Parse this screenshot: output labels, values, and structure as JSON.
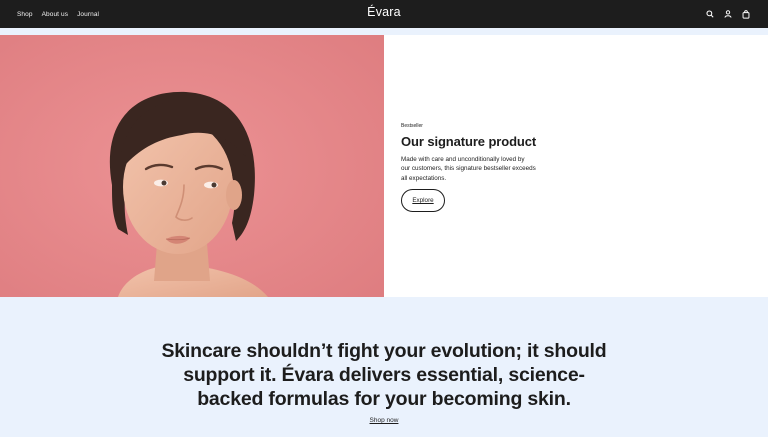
{
  "nav": {
    "items": [
      {
        "label": "Shop"
      },
      {
        "label": "About us"
      },
      {
        "label": "Journal"
      }
    ]
  },
  "brand": {
    "name": "Évara"
  },
  "header_icons": [
    "search-icon",
    "account-icon",
    "cart-icon"
  ],
  "hero": {
    "eyebrow": "Bestseller",
    "title": "Our signature product",
    "description_lines": [
      "Made with care and unconditionally loved by",
      "our customers, this signature bestseller exceeds",
      "all expectations."
    ],
    "cta": "Explore",
    "image_bg": "#e88689"
  },
  "band": {
    "tagline_lines": [
      "Skincare shouldn’t fight your evolution; it should",
      "support it. Évara delivers essential, science-",
      "backed formulas for your becoming skin."
    ],
    "cta": "Shop now"
  },
  "colors": {
    "topbar": "#1d1d1d",
    "band": "#eaf2fd",
    "hero_image_bg": "#e88689"
  }
}
